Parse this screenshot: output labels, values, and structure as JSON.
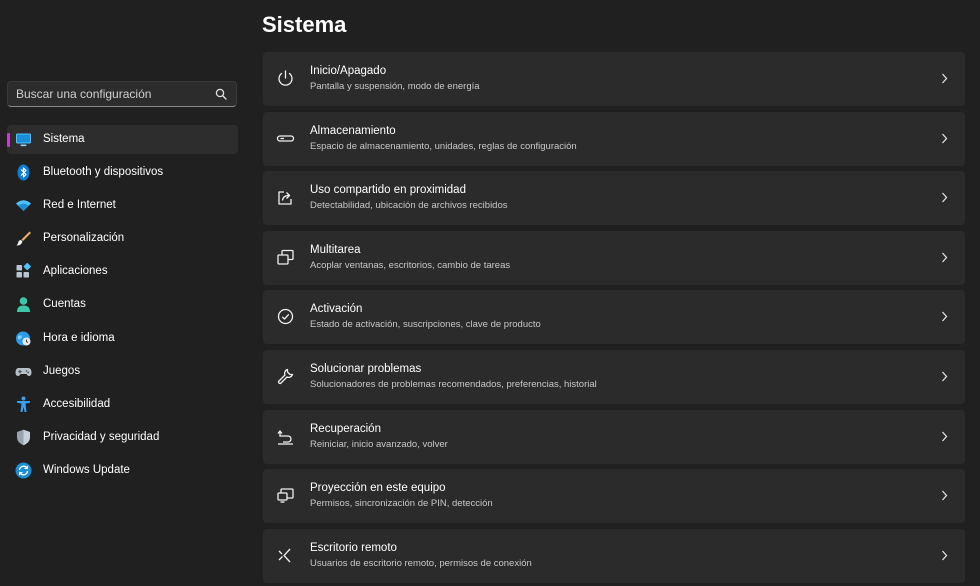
{
  "header": {
    "title": "Sistema"
  },
  "search": {
    "placeholder": "Buscar una configuración"
  },
  "sidebar": {
    "items": [
      {
        "label": "Sistema",
        "icon": "monitor-icon",
        "active": true
      },
      {
        "label": "Bluetooth y dispositivos",
        "icon": "bluetooth-icon",
        "active": false
      },
      {
        "label": "Red e Internet",
        "icon": "wifi-icon",
        "active": false
      },
      {
        "label": "Personalización",
        "icon": "brush-icon",
        "active": false
      },
      {
        "label": "Aplicaciones",
        "icon": "apps-icon",
        "active": false
      },
      {
        "label": "Cuentas",
        "icon": "person-icon",
        "active": false
      },
      {
        "label": "Hora e idioma",
        "icon": "globe-clock-icon",
        "active": false
      },
      {
        "label": "Juegos",
        "icon": "gamepad-icon",
        "active": false
      },
      {
        "label": "Accesibilidad",
        "icon": "accessibility-icon",
        "active": false
      },
      {
        "label": "Privacidad y seguridad",
        "icon": "shield-icon",
        "active": false
      },
      {
        "label": "Windows Update",
        "icon": "update-icon",
        "active": false
      }
    ]
  },
  "main": {
    "cards": [
      {
        "title": "Inicio/Apagado",
        "description": "Pantalla y suspensión, modo de energía",
        "icon": "power-icon"
      },
      {
        "title": "Almacenamiento",
        "description": "Espacio de almacenamiento, unidades, reglas de configuración",
        "icon": "storage-icon"
      },
      {
        "title": "Uso compartido en proximidad",
        "description": "Detectabilidad, ubicación de archivos recibidos",
        "icon": "share-icon"
      },
      {
        "title": "Multitarea",
        "description": "Acoplar ventanas, escritorios, cambio de tareas",
        "icon": "multitask-icon"
      },
      {
        "title": "Activación",
        "description": "Estado de activación, suscripciones, clave de producto",
        "icon": "check-circle-icon"
      },
      {
        "title": "Solucionar problemas",
        "description": "Solucionadores de problemas recomendados, preferencias, historial",
        "icon": "wrench-icon"
      },
      {
        "title": "Recuperación",
        "description": "Reiniciar, inicio avanzado, volver",
        "icon": "recovery-icon"
      },
      {
        "title": "Proyección en este equipo",
        "description": "Permisos, sincronización de PIN, detección",
        "icon": "projection-icon"
      },
      {
        "title": "Escritorio remoto",
        "description": "Usuarios de escritorio remoto, permisos de conexión",
        "icon": "remote-desktop-icon"
      }
    ]
  },
  "colors": {
    "background": "#202020",
    "card": "#2b2b2b",
    "accent": "#c73ecc",
    "sidebar_active": "#2d2d2d",
    "icon_blue": "#4cc2ff"
  }
}
